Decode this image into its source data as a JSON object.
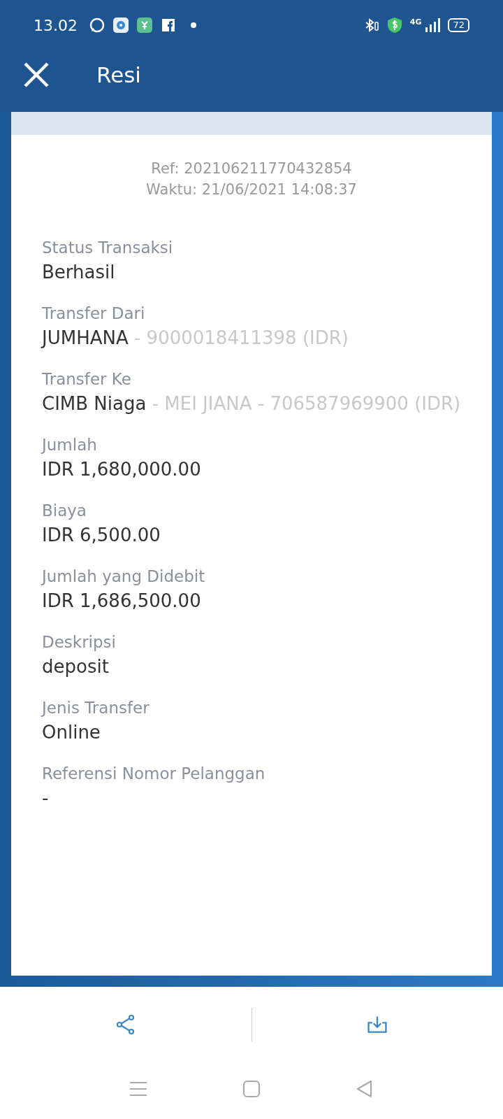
{
  "status_bar": {
    "time": "13.02",
    "network": "4G",
    "battery": "72"
  },
  "header": {
    "title": "Resi"
  },
  "receipt": {
    "ref": "Ref: 202106211770432854",
    "time": "Waktu: 21/06/2021 14:08:37",
    "fields": [
      {
        "label": "Status Transaksi",
        "value": "Berhasil"
      },
      {
        "label": "Transfer Dari",
        "value": "JUMHANA",
        "detail": " - 9000018411398 (IDR)"
      },
      {
        "label": "Transfer Ke",
        "value": "CIMB Niaga",
        "detail": " - MEI JIANA - 706587969900 (IDR)"
      },
      {
        "label": "Jumlah",
        "value": "IDR 1,680,000.00"
      },
      {
        "label": "Biaya",
        "value": "IDR 6,500.00"
      },
      {
        "label": "Jumlah yang Didebit",
        "value": "IDR 1,686,500.00"
      },
      {
        "label": "Deskripsi",
        "value": "deposit"
      },
      {
        "label": "Jenis Transfer",
        "value": "Online"
      },
      {
        "label": "Referensi Nomor Pelanggan",
        "value": "-"
      }
    ]
  }
}
